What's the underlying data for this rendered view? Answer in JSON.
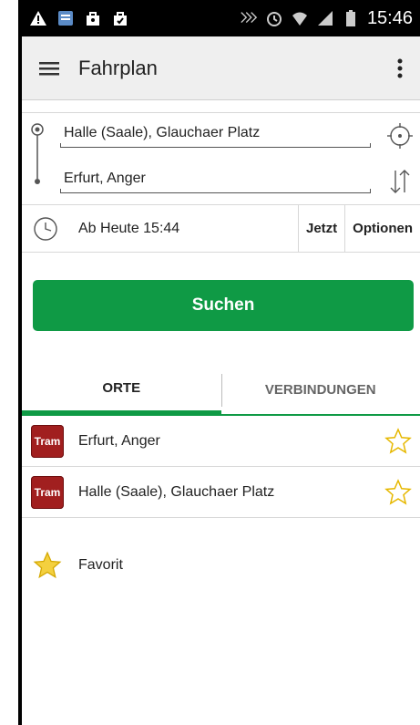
{
  "status_bar": {
    "time": "15:46",
    "left_icons": [
      "warning-icon",
      "app-icon",
      "bag-icon",
      "bag-icon"
    ],
    "right_icons": [
      "nfc-icon",
      "alarm-icon",
      "wifi-icon",
      "signal-icon",
      "battery-icon"
    ]
  },
  "app_bar": {
    "title": "Fahrplan",
    "menu_icon": "hamburger-menu-icon",
    "overflow_icon": "overflow-menu-icon"
  },
  "route": {
    "origin": "Halle (Saale), Glauchaer Platz",
    "destination": "Erfurt, Anger",
    "origin_action_icon": "locate-icon",
    "destination_action_icon": "swap-icon"
  },
  "time": {
    "label": "Ab  Heute 15:44",
    "now_label": "Jetzt",
    "options_label": "Optionen"
  },
  "search": {
    "label": "Suchen"
  },
  "tabs": [
    {
      "label": "ORTE",
      "active": true
    },
    {
      "label": "VERBINDUNGEN",
      "active": false
    }
  ],
  "places": [
    {
      "badge": "Tram",
      "name": "Erfurt, Anger"
    },
    {
      "badge": "Tram",
      "name": "Halle (Saale), Glauchaer Platz"
    }
  ],
  "favorite": {
    "label": "Favorit"
  },
  "colors": {
    "accent": "#0f9a45",
    "tram": "#a11f1f",
    "star": "#f4d03f"
  }
}
